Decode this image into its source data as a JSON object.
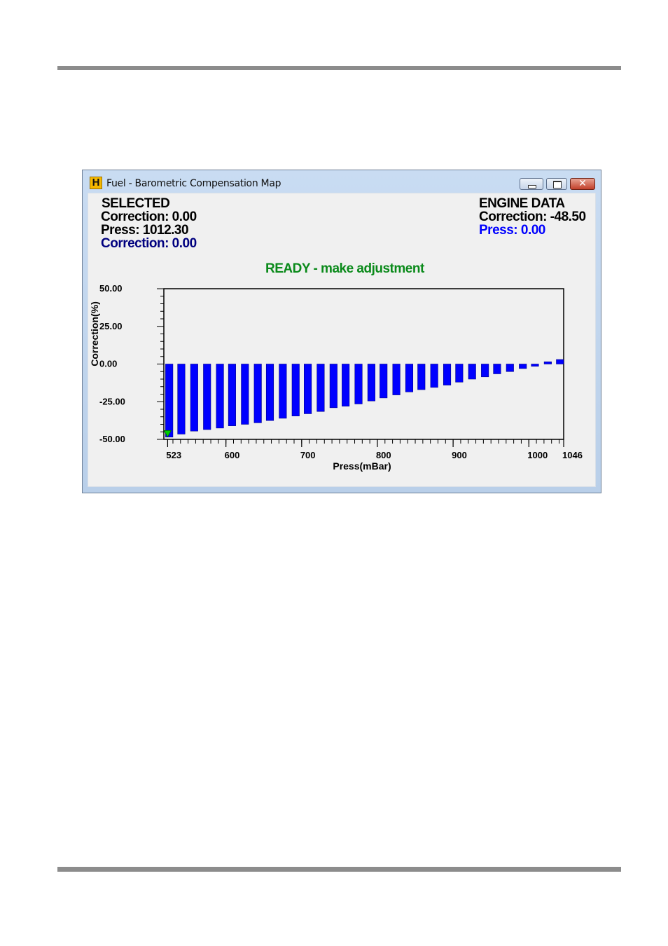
{
  "window": {
    "title": "Fuel - Barometric Compensation Map",
    "icon": "H"
  },
  "selected": {
    "heading": "SELECTED",
    "correction": "Correction: 0.00",
    "press": "Press: 1012.30",
    "correction2": "Correction: 0.00"
  },
  "engine_data": {
    "heading": "ENGINE DATA",
    "correction": "Correction: -48.50",
    "press": "Press: 0.00"
  },
  "status": "READY - make adjustment",
  "chart_data": {
    "type": "bar",
    "title": "",
    "xlabel": "Press(mBar)",
    "ylabel": "Correction(%)",
    "xlim": [
      518,
      1046
    ],
    "ylim": [
      -50,
      50
    ],
    "x_ticks": [
      523,
      600,
      700,
      800,
      900,
      1000,
      1046
    ],
    "y_ticks": [
      "50.00",
      "25.00",
      "0.00",
      "-25.00",
      "-50.00"
    ],
    "y_tick_values": [
      50,
      25,
      0,
      -25,
      -50
    ],
    "x": [
      523,
      539,
      556,
      573,
      590,
      606,
      623,
      640,
      656,
      673,
      690,
      706,
      723,
      740,
      756,
      773,
      790,
      806,
      823,
      840,
      856,
      873,
      890,
      906,
      923,
      940,
      956,
      973,
      990,
      1006,
      1023,
      1040
    ],
    "values": [
      -48.5,
      -46.5,
      -44.5,
      -43.5,
      -42.5,
      -41.0,
      -40.0,
      -39.0,
      -37.5,
      -36.0,
      -34.5,
      -33.0,
      -31.5,
      -29.0,
      -28.0,
      -26.5,
      -24.5,
      -22.5,
      -20.5,
      -18.5,
      -17.0,
      -15.5,
      -14.0,
      -12.0,
      -10.0,
      -8.5,
      -6.5,
      -5.0,
      -3.0,
      -1.5,
      1.5,
      3.0
    ],
    "bar_color": "#0000ff",
    "marker": {
      "x": 523,
      "y": -46,
      "color": "#00cc00"
    },
    "grid": false
  }
}
